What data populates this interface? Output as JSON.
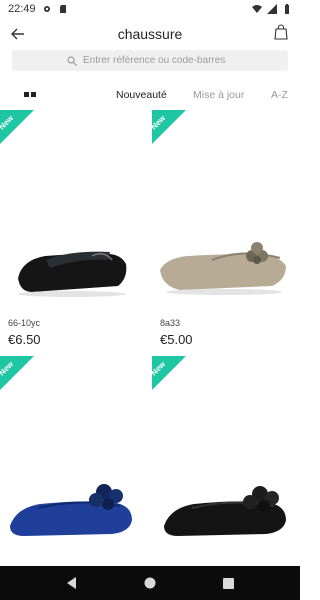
{
  "status_bar": {
    "time": "22:49"
  },
  "header": {
    "title": "chaussure"
  },
  "search": {
    "placeholder": "Entrer référence ou code-barres"
  },
  "sort": {
    "options": [
      "Nouveauté",
      "Mise à jour",
      "A-Z"
    ],
    "active": "Nouveauté"
  },
  "products": [
    {
      "badge": "New",
      "ref": "66-10yc",
      "price": "€6.50"
    },
    {
      "badge": "New",
      "ref": "8a33",
      "price": "€5.00"
    },
    {
      "badge": "New",
      "ref": "",
      "price": ""
    },
    {
      "badge": "New",
      "ref": "",
      "price": ""
    }
  ],
  "colors": {
    "badge": "#1ec6a4",
    "nav_bar": "#0b0b0b"
  }
}
